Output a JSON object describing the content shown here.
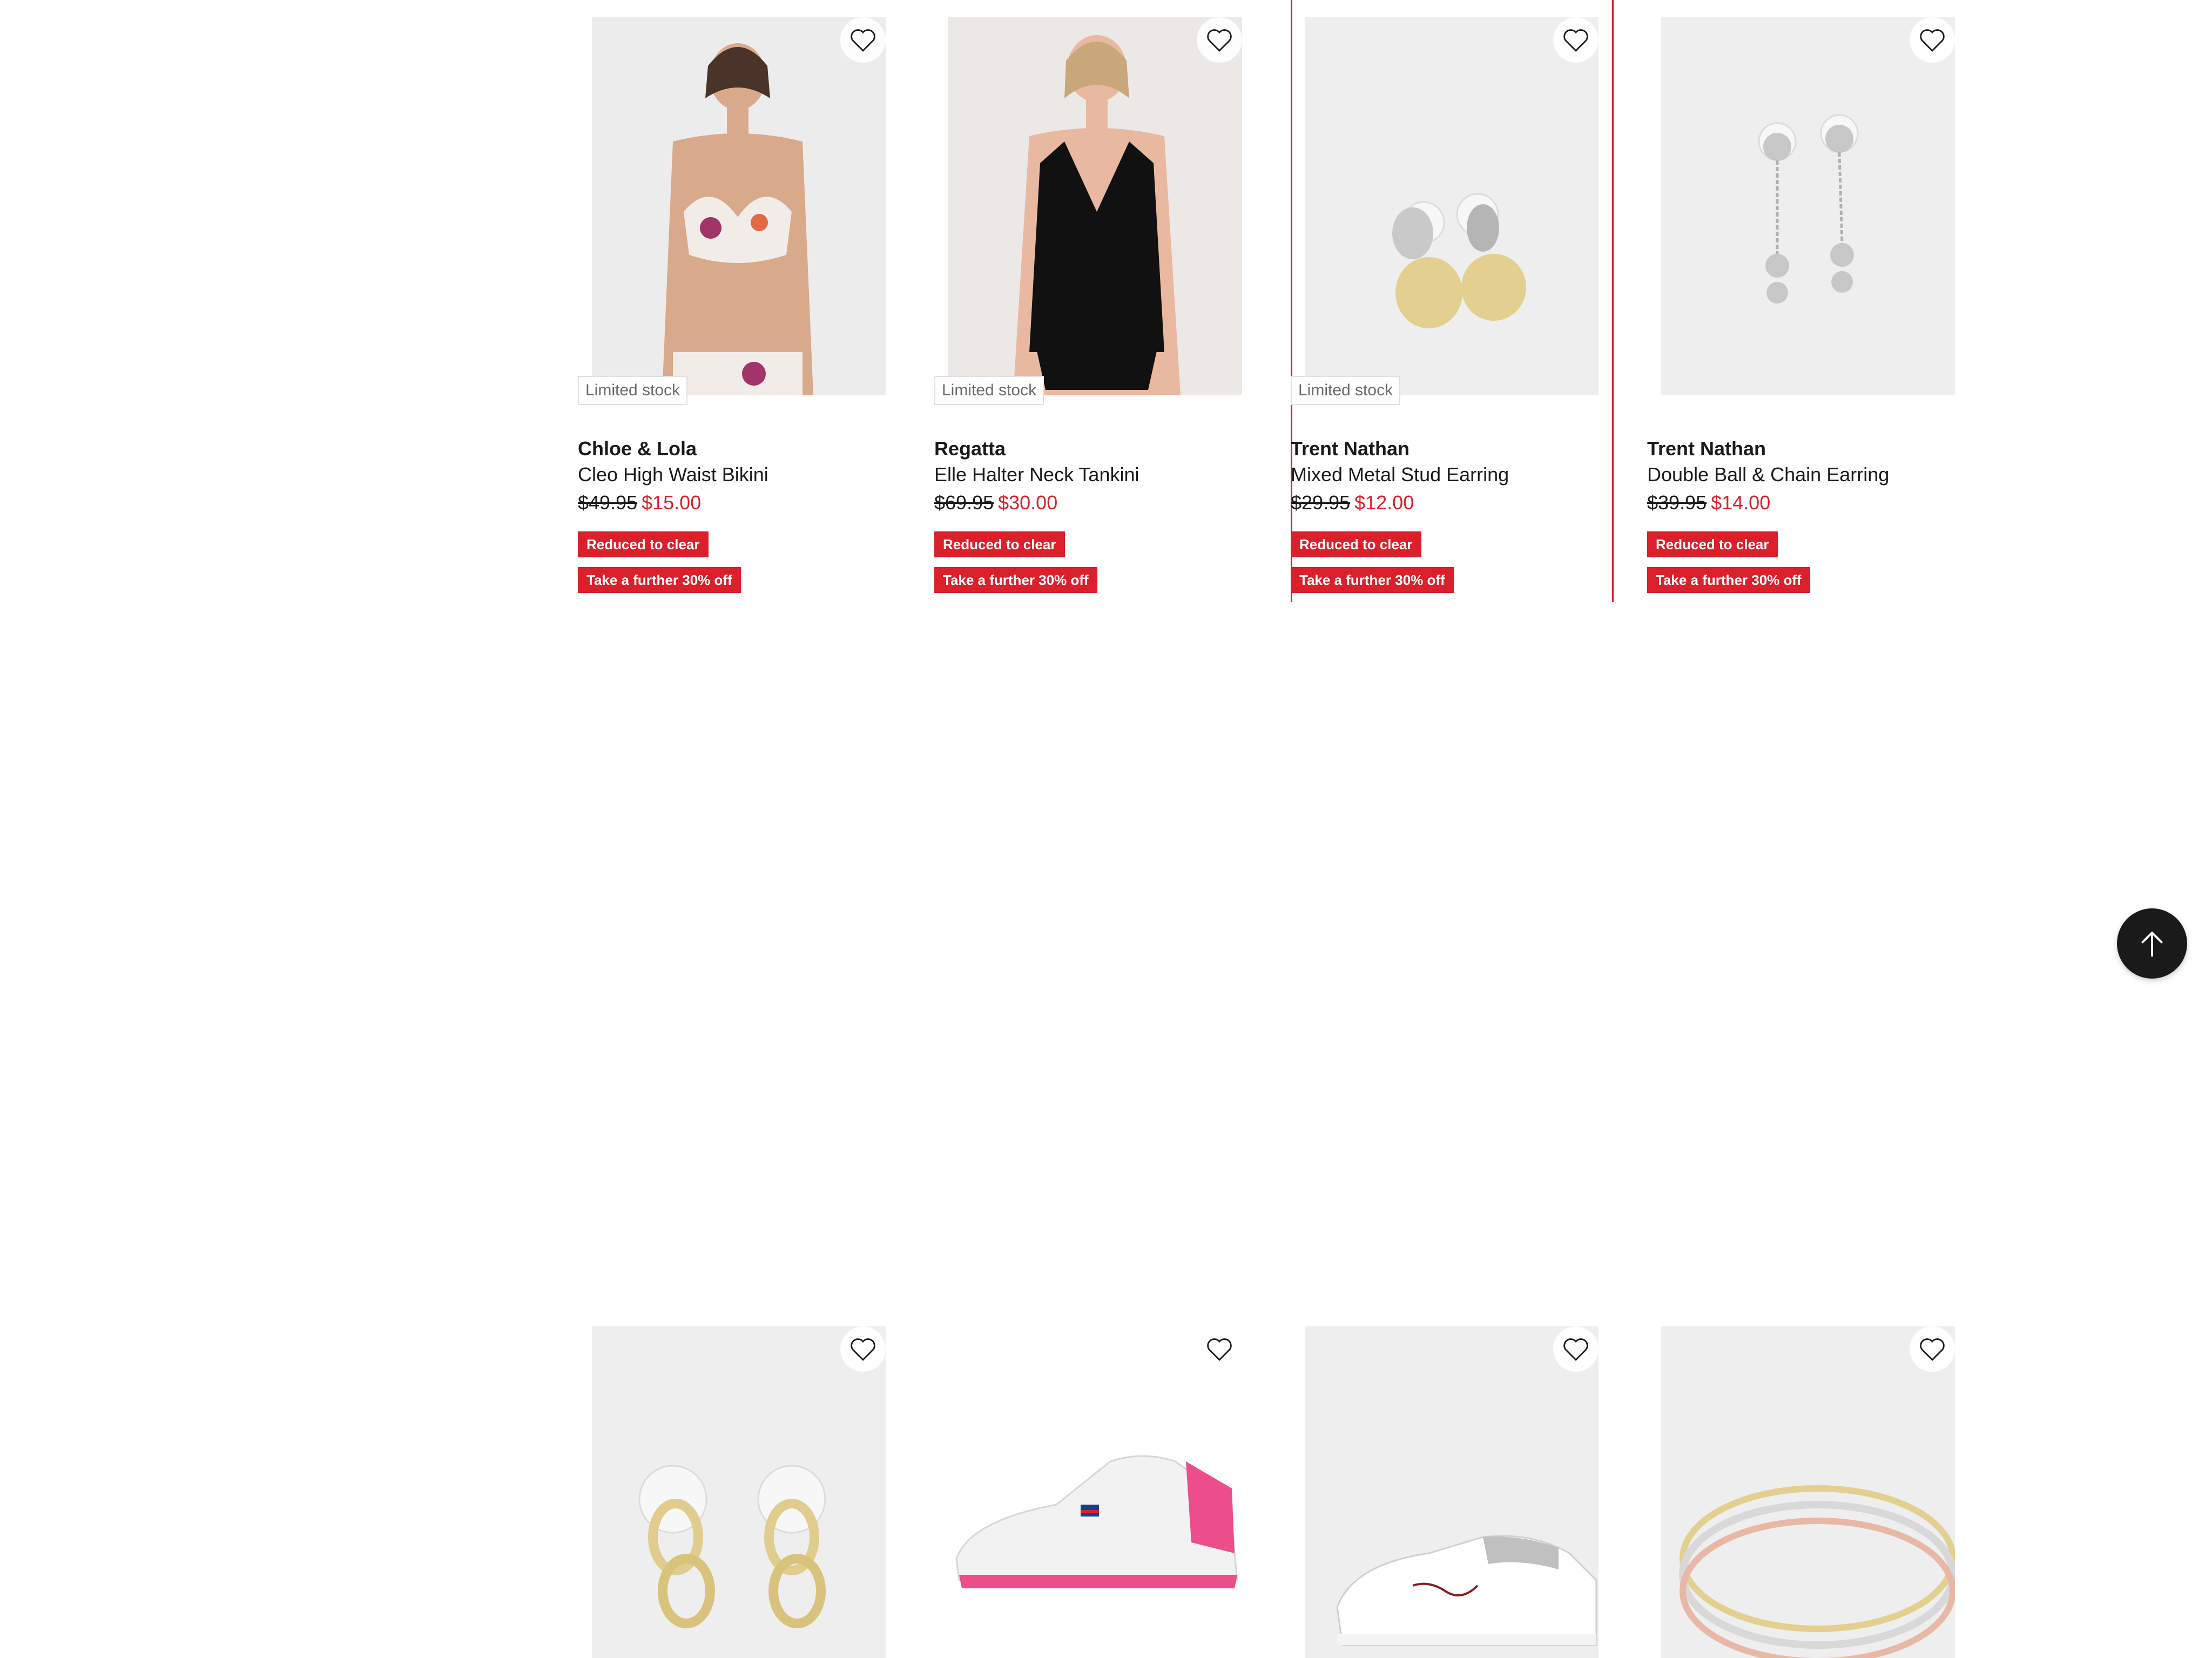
{
  "products": [
    {
      "brand": "Chloe & Lola",
      "name": "Cleo High Waist Bikini",
      "was_price": "$49.95",
      "now_price": "$15.00",
      "stock": "Limited stock",
      "tags": [
        "Reduced to clear",
        "Take a further 30% off"
      ]
    },
    {
      "brand": "Regatta",
      "name": "Elle Halter Neck Tankini",
      "was_price": "$69.95",
      "now_price": "$30.00",
      "stock": "Limited stock",
      "tags": [
        "Reduced to clear",
        "Take a further 30% off"
      ]
    },
    {
      "brand": "Trent Nathan",
      "name": "Mixed Metal Stud Earring",
      "was_price": "$29.95",
      "now_price": "$12.00",
      "stock": "Limited stock",
      "tags": [
        "Reduced to clear",
        "Take a further 30% off"
      ]
    },
    {
      "brand": "Trent Nathan",
      "name": "Double Ball & Chain Earring",
      "was_price": "$39.95",
      "now_price": "$14.00",
      "stock": "",
      "tags": [
        "Reduced to clear",
        "Take a further 30% off"
      ]
    }
  ],
  "colors": {
    "accent_red": "#d9202b",
    "text": "#1a1a1a",
    "muted": "#6b6b6b"
  },
  "icons": {
    "wishlist": "heart-icon",
    "back_to_top": "arrow-up-icon"
  }
}
